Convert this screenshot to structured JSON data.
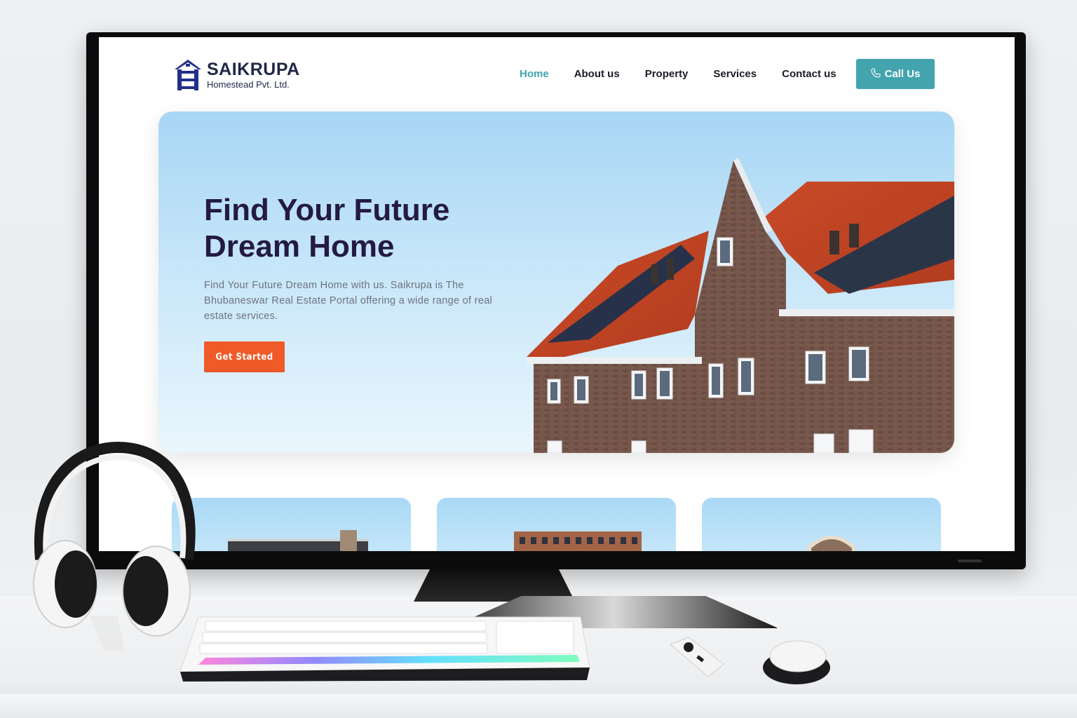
{
  "site": {
    "logo": {
      "name": "SAIKRUPA",
      "subtitle": "Homestead Pvt. Ltd."
    },
    "nav": [
      {
        "label": "Home",
        "active": true
      },
      {
        "label": "About us",
        "active": false
      },
      {
        "label": "Property",
        "active": false
      },
      {
        "label": "Services",
        "active": false
      },
      {
        "label": "Contact us",
        "active": false
      }
    ],
    "call_button": {
      "label": "Call Us",
      "icon": "phone-icon"
    },
    "hero": {
      "title": "Find Your Future\nDream Home",
      "description": "Find Your Future Dream Home with us. Saikrupa is The Bhubaneswar Real Estate Portal offering a wide range of real estate services.",
      "cta_label": "Get Started"
    },
    "colors": {
      "accent": "#43a4ae",
      "cta": "#f05a28",
      "heading": "#241a43",
      "brand": "#1f2748"
    }
  }
}
